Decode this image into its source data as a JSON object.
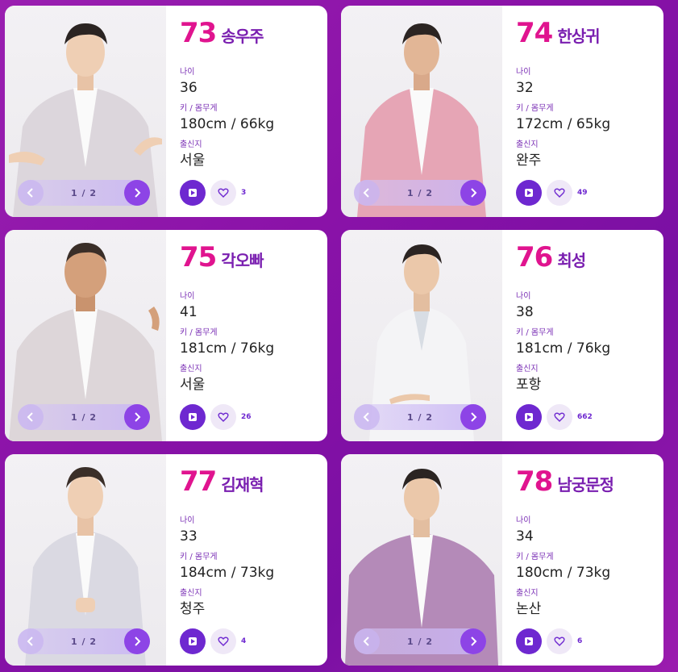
{
  "labels": {
    "age": "나이",
    "height_weight": "키 / 몸무게",
    "hometown": "출신지"
  },
  "colors": {
    "number": "#e0148f",
    "name": "#7a1fb0",
    "accent": "#6e28d0",
    "background": "#8a12a8"
  },
  "icons": {
    "prev": "chevron-left-icon",
    "next": "chevron-right-icon",
    "play": "play-icon",
    "like": "heart-icon"
  },
  "cards": [
    {
      "number": "73",
      "name": "송우주",
      "age": "36",
      "height_weight": "180cm / 66kg",
      "hometown": "서울",
      "page": "1 / 2",
      "likes": "3"
    },
    {
      "number": "74",
      "name": "한상귀",
      "age": "32",
      "height_weight": "172cm / 65kg",
      "hometown": "완주",
      "page": "1 / 2",
      "likes": "49"
    },
    {
      "number": "75",
      "name": "각오빠",
      "age": "41",
      "height_weight": "181cm / 76kg",
      "hometown": "서울",
      "page": "1 / 2",
      "likes": "26"
    },
    {
      "number": "76",
      "name": "최성",
      "age": "38",
      "height_weight": "181cm / 76kg",
      "hometown": "포항",
      "page": "1 / 2",
      "likes": "662"
    },
    {
      "number": "77",
      "name": "김재혁",
      "age": "33",
      "height_weight": "184cm / 73kg",
      "hometown": "청주",
      "page": "1 / 2",
      "likes": "4"
    },
    {
      "number": "78",
      "name": "남궁문정",
      "age": "34",
      "height_weight": "180cm / 73kg",
      "hometown": "논산",
      "page": "1 / 2",
      "likes": "6"
    }
  ]
}
